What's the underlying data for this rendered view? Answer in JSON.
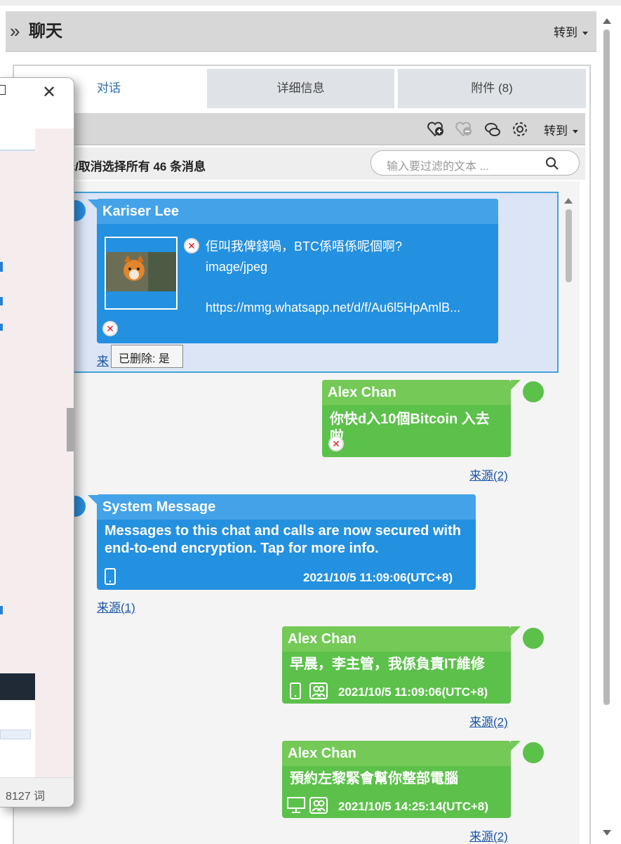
{
  "header": {
    "title": "聊天",
    "goto_label": "转到"
  },
  "tabs": [
    {
      "label": "对话"
    },
    {
      "label": "详细信息"
    },
    {
      "label": "附件 (8)"
    }
  ],
  "toolbar": {
    "goto_label": "转到"
  },
  "selectbar": {
    "select_all_text": "择/取消选择所有 46 条消息",
    "filter_placeholder": "输入要过滤的文本 ..."
  },
  "messages": [
    {
      "sender": "Kariser Lee",
      "text": "佢叫我俾錢喎，BTC係唔係呢個啊?",
      "mime": "image/jpeg",
      "url": "https://mmg.whatsapp.net/d/f/Au6l5HpAmlB...",
      "tooltip": "已删除: 是",
      "source_link": "来"
    },
    {
      "sender": "Alex Chan",
      "text": "你快d入10個Bitcoin 入去啦",
      "source_link": "来源(2)"
    },
    {
      "sender": "System Message",
      "text": "Messages to this chat and calls are now secured with end-to-end encryption. Tap for more info.",
      "timestamp": "2021/10/5 11:09:06(UTC+8)",
      "source_link": "来源(1)"
    },
    {
      "sender": "Alex Chan",
      "text": "早晨，李主管，我係負責IT維修",
      "timestamp": "2021/10/5 11:09:06(UTC+8)",
      "source_link": "来源(2)"
    },
    {
      "sender": "Alex Chan",
      "text": "預約左黎緊會幫你整部電腦",
      "timestamp": "2021/10/5 14:25:14(UTC+8)",
      "source_link": "来源(2)"
    }
  ],
  "overlay_window": {
    "status_text": "8127 词"
  }
}
